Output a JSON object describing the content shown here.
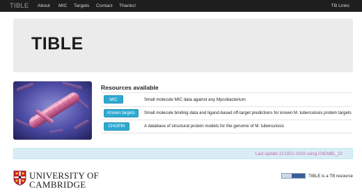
{
  "navbar": {
    "brand": "TIBLE",
    "links": [
      "About",
      "MIC",
      "Targets",
      "Contact",
      "Thanks!"
    ],
    "right_link": "TB Links"
  },
  "jumbotron": {
    "title": "TIBLE"
  },
  "resources": {
    "heading": "Resources available",
    "rows": [
      {
        "button": "MIC",
        "description": "Small molecule MIC data against any Mycobacterium"
      },
      {
        "button": "Known targets",
        "description": "Small molecule binding data and ligand-based off-target predictions for known M. tuberculosis protein targets"
      },
      {
        "button": "CHOPIN",
        "description": "A database of structural protein models for the genome of M. tuberculosis"
      }
    ]
  },
  "update": {
    "text": "Last update 22-DEC-2016 using ChEMBL_22"
  },
  "footer": {
    "logo_line1": "UNIVERSITY OF",
    "logo_line2": "CAMBRIDGE",
    "tb_text": "TIBLE is a TB resource"
  },
  "colors": {
    "navbar": "#1e1e1e",
    "button": "#2ea9d1",
    "update_bg": "#d9edf7",
    "update_text": "#c565a8"
  }
}
